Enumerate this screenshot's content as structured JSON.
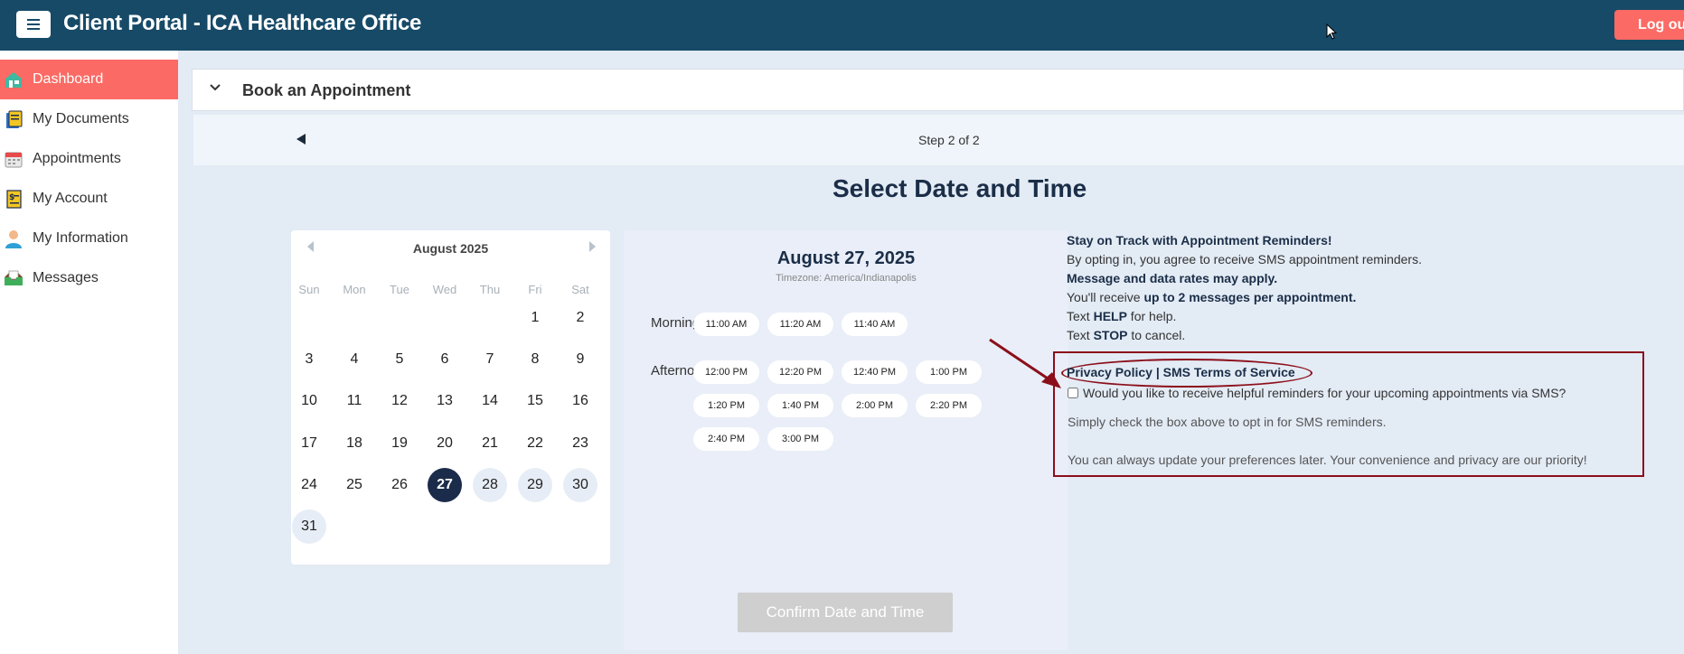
{
  "header": {
    "title": "Client Portal - ICA Healthcare Office",
    "logout_label": "Log out"
  },
  "sidebar": {
    "items": [
      {
        "label": "Dashboard",
        "icon": "dashboard-icon",
        "active": true
      },
      {
        "label": "My Documents",
        "icon": "documents-icon",
        "active": false
      },
      {
        "label": "Appointments",
        "icon": "calendar-icon",
        "active": false
      },
      {
        "label": "My Account",
        "icon": "account-icon",
        "active": false
      },
      {
        "label": "My Information",
        "icon": "user-icon",
        "active": false
      },
      {
        "label": "Messages",
        "icon": "messages-icon",
        "active": false
      }
    ]
  },
  "booking": {
    "section_title": "Book an Appointment",
    "step_text": "Step 2 of 2",
    "heading": "Select Date and Time"
  },
  "calendar": {
    "month_label": "August 2025",
    "weekdays": [
      "Sun",
      "Mon",
      "Tue",
      "Wed",
      "Thu",
      "Fri",
      "Sat"
    ],
    "first_weekday_index": 5,
    "days_in_month": 31,
    "selected_day": 27,
    "available_days": [
      28,
      29,
      30,
      31
    ]
  },
  "times": {
    "date_label": "August 27, 2025",
    "timezone_label": "Timezone: America/Indianapolis",
    "morning_label": "Morning",
    "afternoon_label": "Afternoon",
    "morning": [
      "11:00 AM",
      "11:20 AM",
      "11:40 AM"
    ],
    "afternoon": [
      "12:00 PM",
      "12:20 PM",
      "12:40 PM",
      "1:00 PM",
      "1:20 PM",
      "1:40 PM",
      "2:00 PM",
      "2:20 PM",
      "2:40 PM",
      "3:00 PM"
    ],
    "confirm_label": "Confirm Date and Time"
  },
  "sms": {
    "heading": "Stay on Track with Appointment Reminders!",
    "line1": "By opting in, you agree to receive SMS appointment reminders.",
    "line2": "Message and data rates may apply.",
    "line3_pre": "You'll receive ",
    "line3_bold": "up to 2 messages per appointment.",
    "line4_pre": "Text ",
    "line4_bold": "HELP",
    "line4_post": " for help.",
    "line5_pre": "Text ",
    "line5_bold": "STOP",
    "line5_post": " to cancel.",
    "policy_links": "Privacy Policy | SMS Terms of Service",
    "optin_label": "Would you like to receive helpful reminders for your upcoming appointments via SMS?",
    "optin_checked": false,
    "note1": "Simply check the box above to opt in for SMS reminders.",
    "note2": "You can always update your preferences later. Your convenience and privacy are our priority!"
  },
  "colors": {
    "topbar": "#174a67",
    "accent": "#fb6a64",
    "navy": "#1b2b4a",
    "annotation": "#8b0f1a"
  }
}
